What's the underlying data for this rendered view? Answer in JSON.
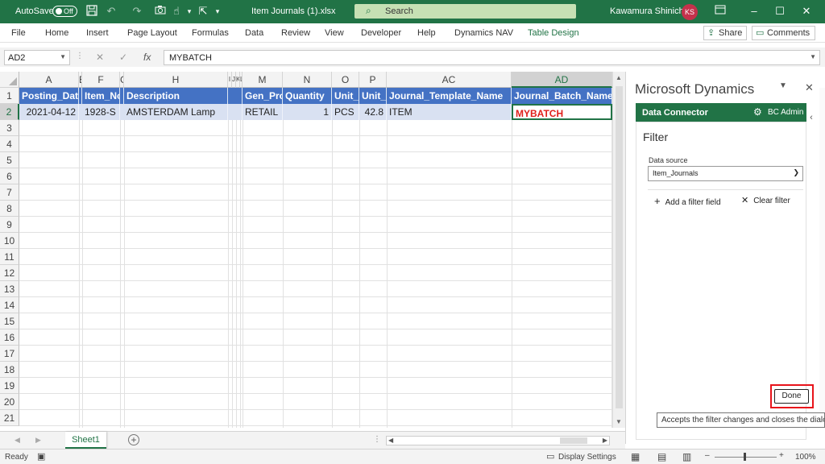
{
  "titlebar": {
    "autosave_label": "AutoSave",
    "autosave_state": "Off",
    "file_title": "Item Journals (1).xlsx",
    "search_placeholder": "Search",
    "user_name": "Kawamura Shinichi",
    "user_initials": "KS",
    "accent_color": "#217346"
  },
  "menu": {
    "items": [
      "File",
      "Home",
      "Insert",
      "Page Layout",
      "Formulas",
      "Data",
      "Review",
      "View",
      "Developer",
      "Help",
      "Dynamics NAV",
      "Table Design"
    ],
    "share_label": "Share",
    "comments_label": "Comments"
  },
  "formula_bar": {
    "name_box": "AD2",
    "formula": "MYBATCH"
  },
  "grid": {
    "columns": [
      "A",
      "E",
      "F",
      "G",
      "H",
      "I",
      "J",
      "K",
      "L",
      "M",
      "N",
      "O",
      "P",
      "AC",
      "AD"
    ],
    "rows": [
      "1",
      "2",
      "3",
      "4",
      "5",
      "6",
      "7",
      "8",
      "9",
      "10",
      "11",
      "12",
      "13",
      "14",
      "15",
      "16",
      "17",
      "18",
      "19",
      "20",
      "21"
    ],
    "header_row": [
      "Posting_Date",
      "Item_No",
      "",
      "Description",
      "",
      "Gen_Prod",
      "Quantity",
      "Unit_",
      "Unit_",
      "Journal_Template_Name",
      "Journal_Batch_Name"
    ],
    "data_row": [
      "2021-04-12",
      "1928-S",
      "",
      "AMSTERDAM Lamp",
      "",
      "RETAIL",
      "1",
      "PCS",
      "42.8",
      "ITEM",
      "MYBATCH"
    ],
    "header_color": "#4472c4",
    "band_color": "#d9e1f2",
    "highlight_text_color": "#e0201b"
  },
  "sheet": {
    "tab_label": "Sheet1"
  },
  "status": {
    "ready": "Ready",
    "display_settings": "Display Settings",
    "zoom": "100%"
  },
  "pane": {
    "title": "Microsoft Dynamics",
    "connector_label": "Data Connector",
    "user_label": "BC Admin",
    "filter_title": "Filter",
    "data_source_label": "Data source",
    "data_source_value": "Item_Journals",
    "add_filter_label": "Add a filter field",
    "clear_filter_label": "Clear filter",
    "done_label": "Done",
    "tooltip": "Accepts the filter changes and closes the dialog",
    "highlight_color": "#e8141b"
  }
}
